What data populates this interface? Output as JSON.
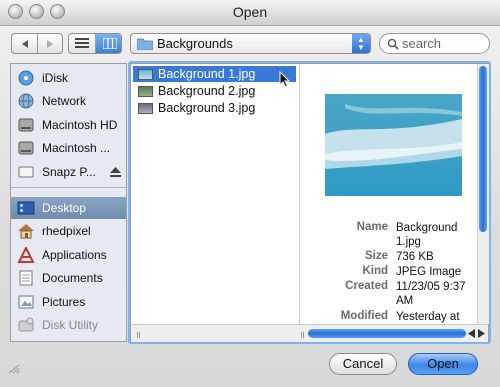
{
  "window": {
    "title": "Open"
  },
  "toolbar": {
    "location": "Backgrounds",
    "search_placeholder": "search"
  },
  "sidebar": {
    "items": [
      {
        "label": "iDisk",
        "icon": "idisk-icon"
      },
      {
        "label": "Network",
        "icon": "network-globe-icon"
      },
      {
        "label": "Macintosh HD",
        "icon": "hard-drive-icon"
      },
      {
        "label": "Macintosh ...",
        "icon": "hard-drive-icon"
      },
      {
        "label": "Snapz P...",
        "icon": "disk-image-icon"
      },
      {
        "label": "Desktop",
        "icon": "desktop-icon"
      },
      {
        "label": "rhedpixel",
        "icon": "home-icon"
      },
      {
        "label": "Applications",
        "icon": "applications-icon"
      },
      {
        "label": "Documents",
        "icon": "documents-folder-icon"
      },
      {
        "label": "Pictures",
        "icon": "pictures-folder-icon"
      },
      {
        "label": "Disk Utility",
        "icon": "disk-utility-icon"
      }
    ]
  },
  "files": [
    {
      "name": "Background 1.jpg",
      "selected": true
    },
    {
      "name": "Background 2.jpg",
      "selected": false
    },
    {
      "name": "Background 3.jpg",
      "selected": false
    }
  ],
  "preview": {
    "labels": {
      "name": "Name",
      "size": "Size",
      "kind": "Kind",
      "created": "Created",
      "modified": "Modified"
    },
    "name": "Background 1.jpg",
    "size": "736 KB",
    "kind": "JPEG Image",
    "created": "11/23/05 9:37 AM",
    "modified": "Yesterday at"
  },
  "buttons": {
    "cancel": "Cancel",
    "open": "Open"
  },
  "colors": {
    "selection": "#3a78d9",
    "focus_ring": "#7fb2ee",
    "default_button": "#3b86e8"
  }
}
